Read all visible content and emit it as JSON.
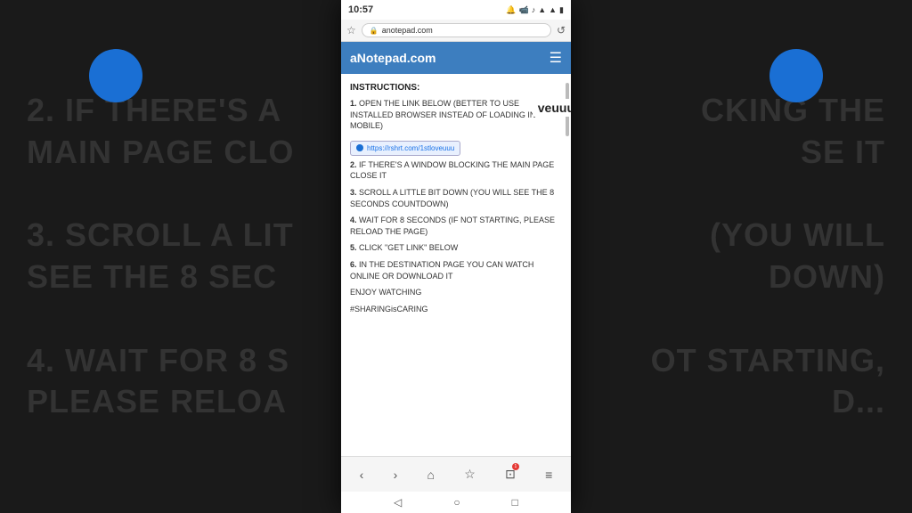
{
  "background": {
    "left_text_lines": [
      "2. IF THERE'S A",
      "MAIN PAGE CLO",
      "",
      "3. SCROLL A LIT",
      "SEE THE 8 SEC",
      "",
      "4. WAIT FOR 8 S",
      "PLEASE RELOA"
    ],
    "right_text_lines": [
      "CKING THE",
      "SE IT",
      "",
      "(YOU WILL",
      "DOWN)",
      "",
      "OT STARTING,",
      "D..."
    ]
  },
  "status_bar": {
    "time": "10:57",
    "icons": "🔔 📹 🎵 📶 🔋"
  },
  "browser": {
    "url": "anotepad.com",
    "favicon": "🔒"
  },
  "app_bar": {
    "title": "aNotepad.com",
    "menu_icon": "☰"
  },
  "content": {
    "header": "INSTRUCTIONS:",
    "items": [
      {
        "number": "1.",
        "text": "OPEN THE LINK BELOW (BETTER TO USE INSTALLED BROWSER INSTEAD OF LOADING IN MOBILE)"
      },
      {
        "link": "https://rshrt.com/1stloveuuu"
      },
      {
        "number": "2.",
        "text": "IF THERE'S A WINDOW BLOCKING THE MAIN PAGE CLOSE IT"
      },
      {
        "number": "3.",
        "text": "SCROLL A LITTLE BIT DOWN (YOU WILL SEE THE 8 SECONDS COUNTDOWN)"
      },
      {
        "number": "4.",
        "text": "WAIT FOR 8 SECONDS (IF NOT STARTING, PLEASE RELOAD THE PAGE)"
      },
      {
        "number": "5.",
        "text": "CLICK \"GET LINK\" BELOW"
      },
      {
        "number": "6.",
        "text": "IN THE DESTINATION PAGE YOU CAN WATCH ONLINE OR DOWNLOAD IT"
      }
    ],
    "enjoy": "ENJOY WATCHING",
    "sharing": "#SHARINGisCARING"
  },
  "floating_word": "veuuu",
  "bottom_nav": {
    "icons": [
      "‹",
      "›",
      "⌂",
      "☆",
      "⊡",
      "≡"
    ]
  },
  "android_nav": {
    "icons": [
      "◁",
      "○",
      "□"
    ]
  }
}
